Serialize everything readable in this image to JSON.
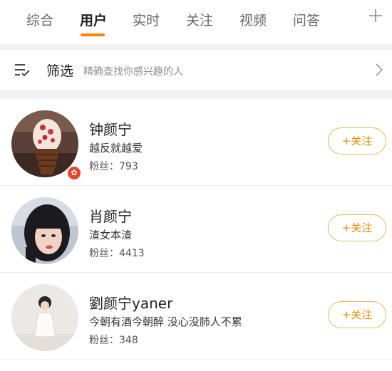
{
  "tabs": [
    {
      "label": "综合",
      "active": false
    },
    {
      "label": "用户",
      "active": true
    },
    {
      "label": "实时",
      "active": false
    },
    {
      "label": "关注",
      "active": false
    },
    {
      "label": "视频",
      "active": false
    },
    {
      "label": "问答",
      "active": false
    }
  ],
  "tab_add_icon": "plus-icon",
  "accent_color": "#ff8200",
  "filter": {
    "icon": "filter-list-icon",
    "title": "筛选",
    "hint": "精确查找你感兴趣的人",
    "arrow_icon": "chevron-right-icon"
  },
  "users": [
    {
      "name": "钟颜宁",
      "description": "越反就越爱",
      "fans": "粉丝：793",
      "follow_label": "+关注",
      "avatar": "ice-cream-photo",
      "has_badge": true
    },
    {
      "name": "肖颜宁",
      "description": "渣女本渣",
      "fans": "粉丝：4413",
      "follow_label": "+关注",
      "avatar": "girl-portrait-photo",
      "has_badge": false
    },
    {
      "name": "劉颜宁yaner",
      "description": "今朝有酒今朝醉 没心没肺人不累",
      "fans": "粉丝：348",
      "follow_label": "+关注",
      "avatar": "child-in-white-dress-photo",
      "has_badge": false
    }
  ]
}
